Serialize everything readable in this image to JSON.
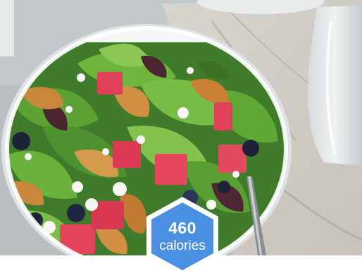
{
  "calorie_badge": {
    "number": "460",
    "unit": "calories",
    "fill_color": "#4a90e2",
    "border_color": "#ffffff"
  },
  "photo": {
    "icon": "salad-photo"
  }
}
